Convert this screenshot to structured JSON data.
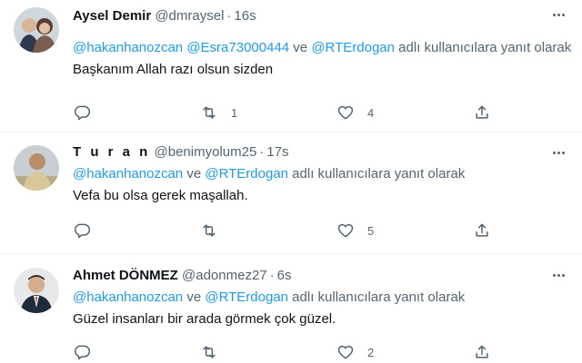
{
  "tweets": [
    {
      "name": "Aysel Demir",
      "handle": "@dmraysel",
      "dot": "·",
      "time": "16s",
      "reply_prefix": "",
      "mentions": [
        "@hakanhanozcan",
        "@Esra73000444",
        "@RTErdogan"
      ],
      "joiner_1": " ",
      "joiner_2": " ve ",
      "reply_suffix": " adlı kullanıcılara yanıt olarak",
      "text": "Başkanım Allah razı olsun sizden",
      "retweets": "1",
      "likes": "4"
    },
    {
      "name": "T u r a n",
      "handle": "@benimyolum25",
      "dot": "·",
      "time": "17s",
      "mentions": [
        "@hakanhanozcan",
        "@RTErdogan"
      ],
      "joiner_1": " ve ",
      "reply_suffix": " adlı kullanıcılara yanıt olarak",
      "text": "Vefa bu olsa gerek maşallah.",
      "retweets": "",
      "likes": "5"
    },
    {
      "name": "Ahmet DÖNMEZ",
      "handle": "@adonmez27",
      "dot": "·",
      "time": "6s",
      "mentions": [
        "@hakanhanozcan",
        "@RTErdogan"
      ],
      "joiner_1": " ve ",
      "reply_suffix": " adlı kullanıcılara yanıt olarak",
      "text": "Güzel insanları bir arada görmek çok güzel.",
      "retweets": "",
      "likes": "2"
    }
  ],
  "icons": {
    "reply": "reply-icon",
    "retweet": "retweet-icon",
    "like": "heart-icon",
    "share": "share-icon",
    "more": "more-icon"
  },
  "colors": {
    "link": "#1d9bf0",
    "secondary": "#536471",
    "primary_text": "#0f1419",
    "divider": "#eff3f4"
  }
}
